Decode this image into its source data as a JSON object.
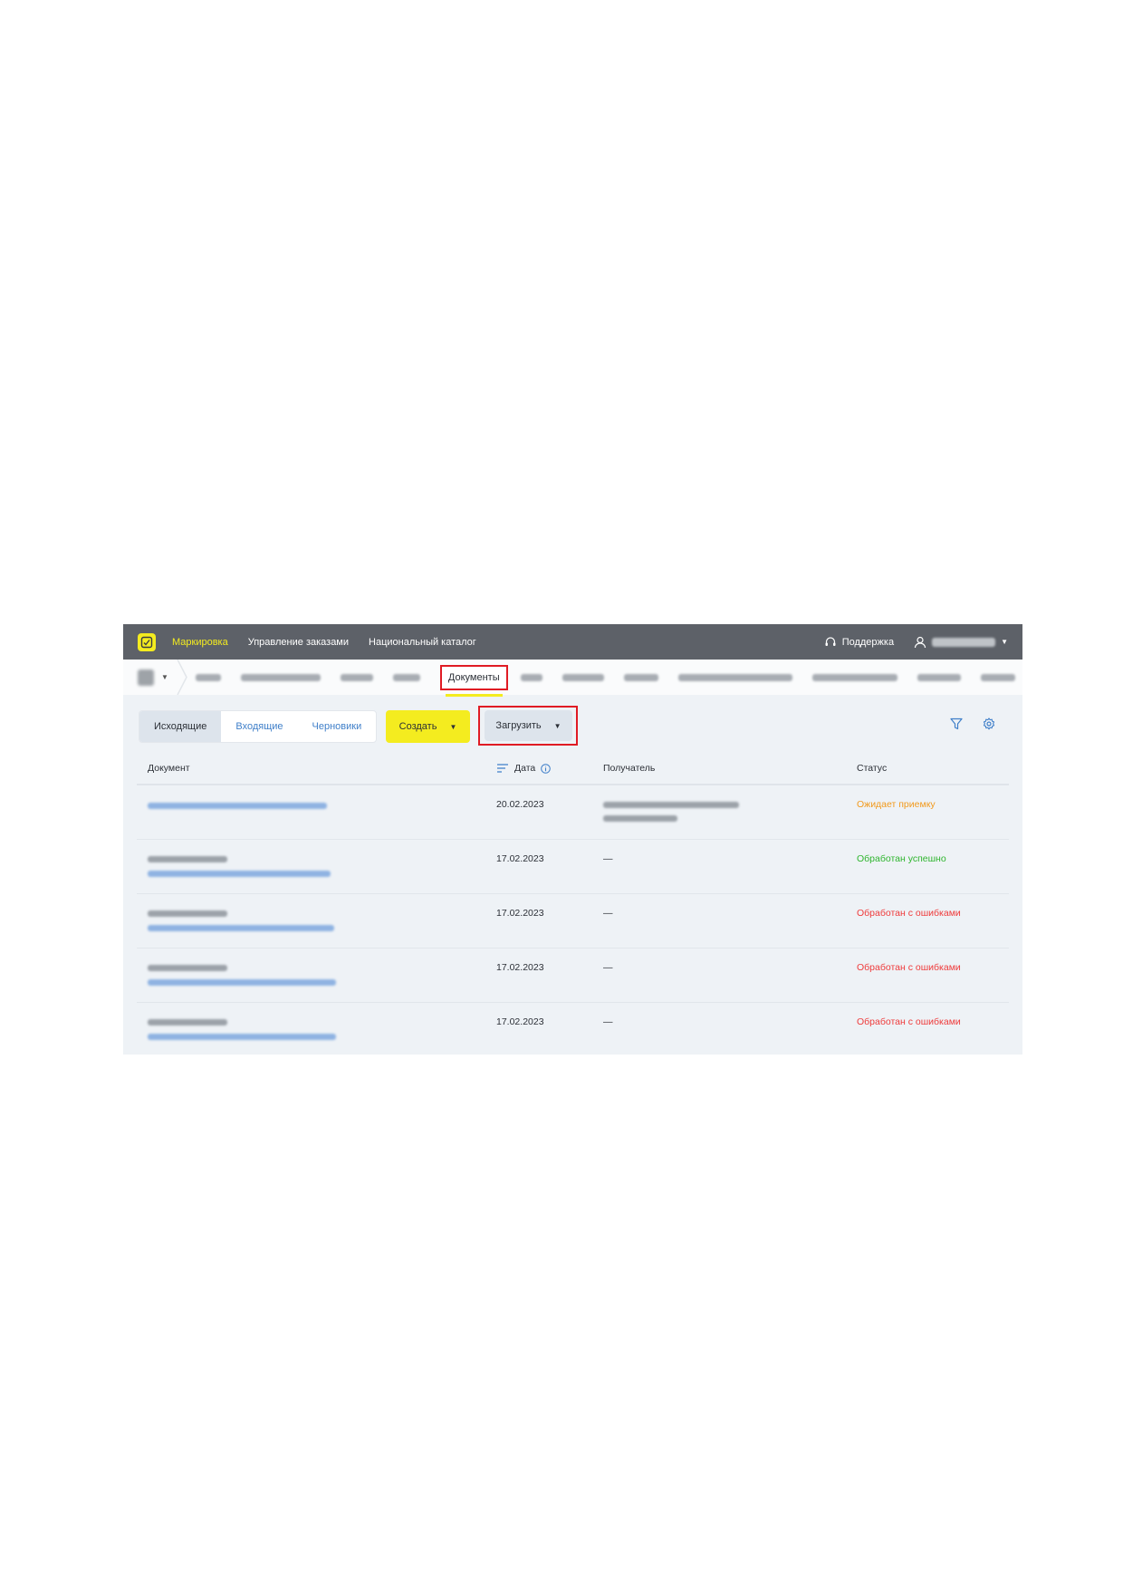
{
  "topbar": {
    "items": [
      {
        "label": "Маркировка",
        "active": true
      },
      {
        "label": "Управление заказами",
        "active": false
      },
      {
        "label": "Национальный каталог",
        "active": false
      }
    ],
    "support_label": "Поддержка"
  },
  "subnav": {
    "active_tab": "Документы"
  },
  "toolbar": {
    "segments": [
      "Исходящие",
      "Входящие",
      "Черновики"
    ],
    "create_label": "Создать",
    "upload_label": "Загрузить"
  },
  "table": {
    "headers": {
      "document": "Документ",
      "date": "Дата",
      "recipient": "Получатель",
      "status": "Статус"
    },
    "rows": [
      {
        "date": "20.02.2023",
        "recipient": "",
        "status": "Ожидает приемку",
        "status_type": "wait"
      },
      {
        "date": "17.02.2023",
        "recipient": "—",
        "status": "Обработан успешно",
        "status_type": "ok"
      },
      {
        "date": "17.02.2023",
        "recipient": "—",
        "status": "Обработан с ошибками",
        "status_type": "err"
      },
      {
        "date": "17.02.2023",
        "recipient": "—",
        "status": "Обработан с ошибками",
        "status_type": "err"
      },
      {
        "date": "17.02.2023",
        "recipient": "—",
        "status": "Обработан с ошибками",
        "status_type": "err"
      }
    ]
  },
  "colors": {
    "brand_yellow": "#f4ec1f",
    "topbar_bg": "#5d6168",
    "highlight_red": "#e01b24",
    "link_blue": "#3f7fc9"
  }
}
